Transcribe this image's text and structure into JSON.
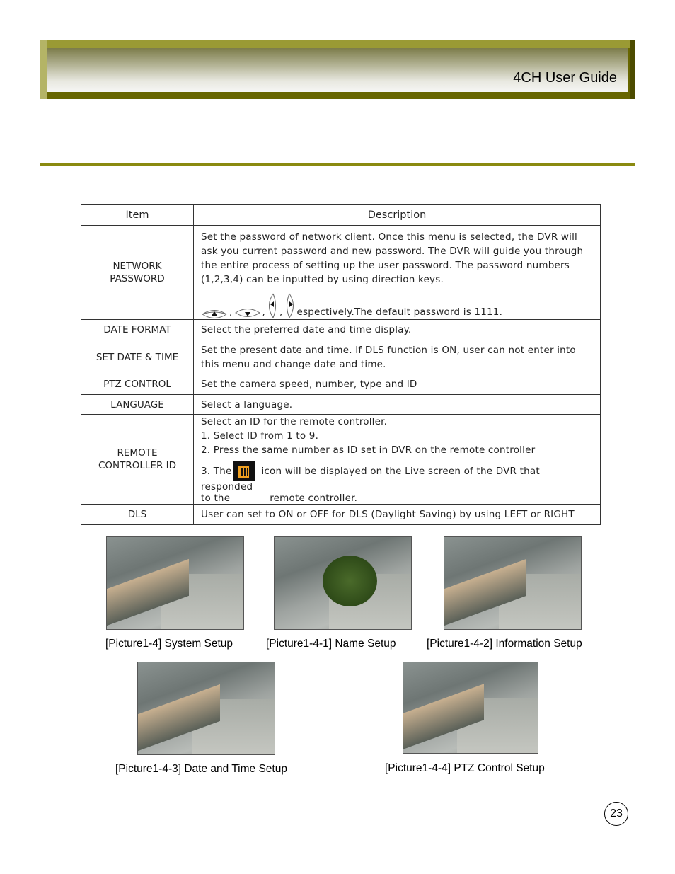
{
  "header": {
    "title": "4CH User Guide"
  },
  "table": {
    "columns": [
      "Item",
      "Description"
    ],
    "rows": [
      {
        "item": [
          "NETWORK",
          "PASSWORD"
        ],
        "desc": [
          "Set the password of network client. Once this menu is selected, the DVR will ask you current password and new password. The DVR will guide you through the entire process of setting up the user password. The password numbers (1,2,3,4) can be inputted by using direction keys."
        ],
        "tail": "espectively.The default password is 1111."
      },
      {
        "item": [
          "DATE FORMAT"
        ],
        "desc": [
          "Select the preferred date and time display."
        ]
      },
      {
        "item": [
          "SET DATE & TIME"
        ],
        "desc": [
          "Set the present date and time. If DLS function is ON, user can not enter into this menu and change date and time."
        ]
      },
      {
        "item": [
          "PTZ CONTROL"
        ],
        "desc": [
          "Set the camera speed, number, type and ID"
        ]
      },
      {
        "item": [
          "LANGUAGE"
        ],
        "desc": [
          "Select a language."
        ]
      },
      {
        "item": [
          "REMOTE",
          "CONTROLLER ID"
        ],
        "desc": [
          "Select an ID for the remote controller.",
          "1. Select ID from 1 to 9.",
          "2. Press the same number as ID set in DVR on the remote controller"
        ],
        "line3a": "3. The",
        "line3b": "icon will be displayed on the Live screen of the DVR that responded",
        "line4a": "to the",
        "line4b": "remote controller."
      },
      {
        "item": [
          "DLS"
        ],
        "desc": [
          "User can set to ON or OFF for DLS (Daylight Saving) by using LEFT or RIGHT"
        ]
      }
    ]
  },
  "figures": [
    {
      "caption": "[Picture1-4] System Setup"
    },
    {
      "caption": "[Picture1-4-1] Name Setup"
    },
    {
      "caption": "[Picture1-4-2] Information Setup"
    },
    {
      "caption": "[Picture1-4-3] Date and Time Setup"
    },
    {
      "caption": "[Picture1-4-4] PTZ Control Setup"
    }
  ],
  "page_number": "23",
  "colors": {
    "banner": "#676600",
    "rule": "#8a8a10"
  }
}
